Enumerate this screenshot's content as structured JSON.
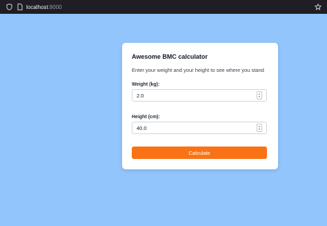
{
  "browser": {
    "url_host": "localhost",
    "url_port": ":8000",
    "icons": [
      "shield-icon",
      "page-icon",
      "star-icon"
    ]
  },
  "card": {
    "title": "Awesome BMC calculator",
    "subtitle": "Enter your weight and your height to see where you stand",
    "weight": {
      "label": "Weight (kg):",
      "value": "2.0"
    },
    "height": {
      "label": "Height (cm):",
      "value": "40.0"
    },
    "button_label": "Calculate"
  },
  "colors": {
    "background": "#93c5fd",
    "accent": "#f97316",
    "card": "#ffffff"
  }
}
